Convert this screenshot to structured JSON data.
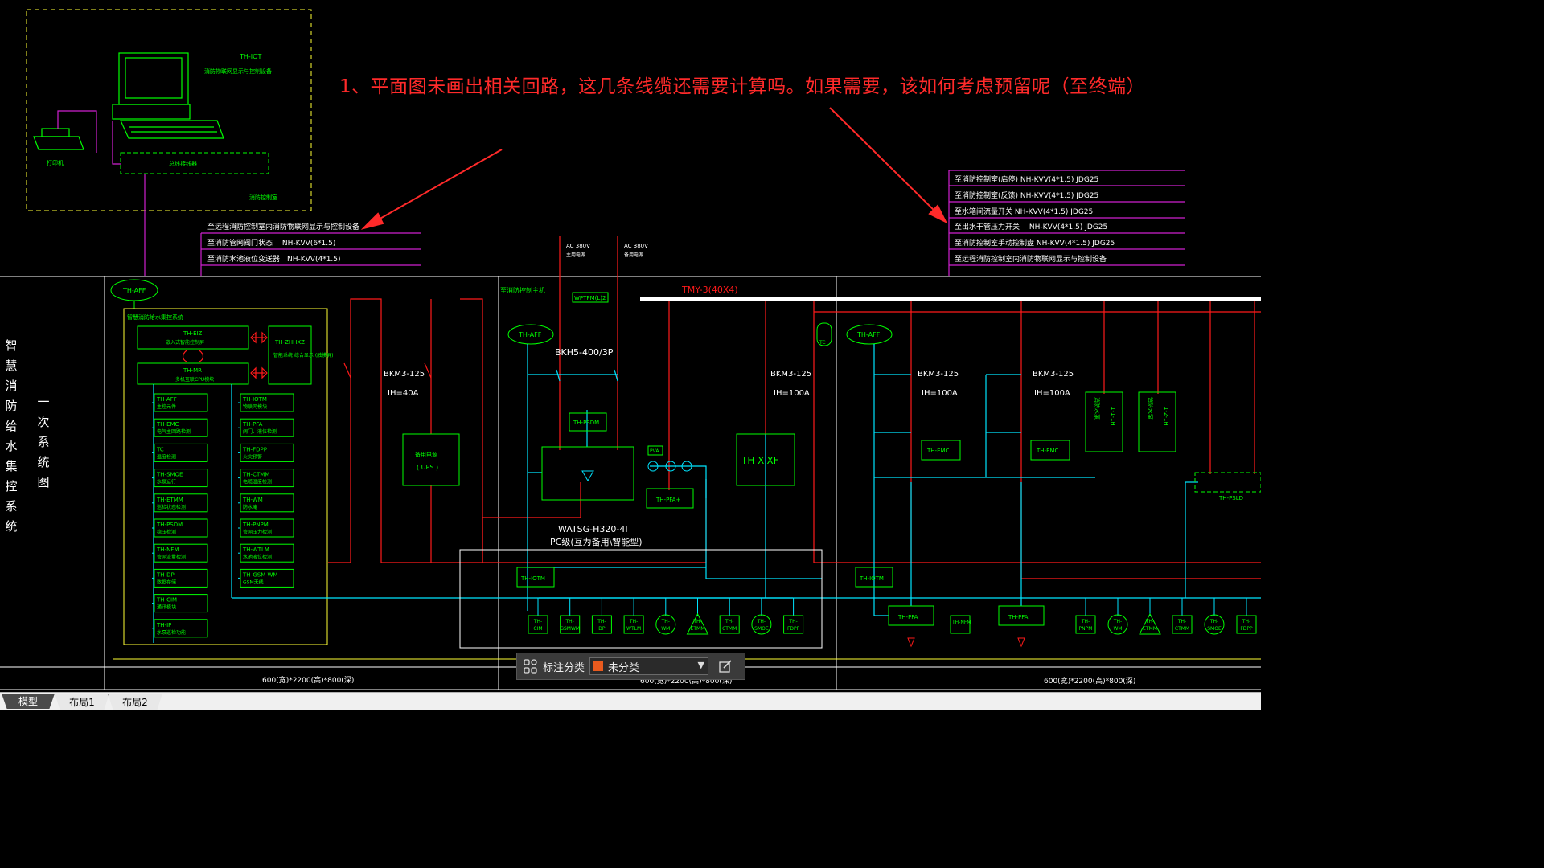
{
  "annotation": {
    "text": "1、平面图未画出相关回路，这几条线缆还需要计算吗。如果需要，该如何考虑预留呢（至终端）"
  },
  "title_vertical": [
    "智",
    "慧",
    "消",
    "防",
    "给",
    "水",
    "集",
    "控",
    "系",
    "统"
  ],
  "title_vertical_2": [
    "一",
    "次",
    "系",
    "统",
    "图"
  ],
  "top_left": {
    "device": "TH-IOT",
    "device_desc": "消防物联网显示与控制设备",
    "printer": "打印机",
    "bus": "总线接线器",
    "room": "消防控制室"
  },
  "cables_left": [
    "至远程消防控制室内消防物联网显示与控制设备",
    "至消防管网阀门状态　 NH-KVV(6*1.5)",
    "至消防水池液位变送器　NH-KVV(4*1.5)"
  ],
  "cables_right": [
    "至消防控制室(启停) NH-KVV(4*1.5) JDG25",
    "至消防控制室(反馈) NH-KVV(4*1.5) JDG25",
    "至水箱间流量开关 NH-KVV(4*1.5) JDG25",
    "至出水干管压力开关　 NH-KVV(4*1.5) JDG25",
    "至消防控制室手动控制盘 NH-KVV(4*1.5) JDG25",
    "至远程消防控制室内消防物联网显示与控制设备"
  ],
  "panel1": {
    "aff": "TH-AFF",
    "box_title": "智慧消防给水集控系统",
    "eiz": "TH-EIZ",
    "eiz_desc": "嵌入式智能控制屏",
    "mr": "TH-MR",
    "mr_desc": "多机互联CPU模块",
    "zhhxz": "TH-ZHHXZ",
    "zhhxz_desc": "智能系统 综合显示 (触摸屏)",
    "left_modules": [
      {
        "code": "TH-AFF",
        "desc": "主控元件"
      },
      {
        "code": "TH-EMC",
        "desc": "电气主回路检测"
      },
      {
        "code": "TC",
        "desc": "温度检测"
      },
      {
        "code": "TH-SMOE",
        "desc": "水泵运行"
      },
      {
        "code": "TH-ETMM",
        "desc": "巡检状态检测"
      },
      {
        "code": "TH-PSDM",
        "desc": "稳压检测"
      },
      {
        "code": "TH-NFM",
        "desc": "管网流量检测"
      },
      {
        "code": "TH-DP",
        "desc": "数据存储"
      },
      {
        "code": "TH-CIM",
        "desc": "通讯模块"
      },
      {
        "code": "TH-IP",
        "desc": "水泵巡检功能"
      }
    ],
    "right_modules": [
      {
        "code": "TH-IOTM",
        "desc": "物联网模块"
      },
      {
        "code": "TH-PFA",
        "desc": "阀门、液位检测"
      },
      {
        "code": "TH-FDPP",
        "desc": "火灾预警"
      },
      {
        "code": "TH-CTMM",
        "desc": "电缆温度检测"
      },
      {
        "code": "TH-WM",
        "desc": "防水淹"
      },
      {
        "code": "TH-PNPM",
        "desc": "管网压力检测"
      },
      {
        "code": "TH-WTLM",
        "desc": "水池液位检测"
      },
      {
        "code": "TH-GSM-WM",
        "desc": "GSM无线"
      }
    ],
    "bkm_label": "BKM3-125",
    "ih_label": "IH=40A",
    "ups_label": "备用电源",
    "ups_sub": "( UPS )",
    "footer": "600(宽)*2200(高)*800(深)"
  },
  "panel2": {
    "header": "至消防控制主机",
    "ac1": "AC 380V",
    "ac1_sub": "主用电源",
    "ac2": "AC 380V",
    "ac2_sub": "备用电源",
    "wptpm": "WPTPM(L)2",
    "aff": "TH-AFF",
    "bkh": "BKH5-400/3P",
    "psdm": "TH-PSDM",
    "pva": "PVA",
    "pfa_plus": "TH-PFA+",
    "watsg": "WATSG-H320-4I",
    "pc_label": "PC级(互为备用\\智能型)",
    "iotm": "TH-IOTM",
    "bus_label": "TMY-3(40X4)",
    "tc": "TC",
    "bkm_label": "BKM3-125",
    "ih_label": "IH=100A",
    "xf_label": "TH-X-XF",
    "bottom_modules": [
      "TH-CIM",
      "TH-GSMWM",
      "TH-DP",
      "TH-WTLM",
      "TH-WM",
      "TH-ETMM",
      "TH-CTMM",
      "TH-SMOE",
      "TH-FDPP"
    ],
    "footer": "600(宽)*2200(高)*800(深)"
  },
  "panel3": {
    "aff": "TH-AFF",
    "bkm_label": "BKM3-125",
    "ih_label": "IH=100A",
    "emc": "TH-EMC",
    "pump_label": "消防水泵",
    "pump_code": "1-1-1H",
    "pump_code_2": "1-2-1H",
    "iotm": "TH-IOTM",
    "pfa": "TH-PFA",
    "nfm": "TH-NFM",
    "psld": "TH-PSLD",
    "bottom_modules": [
      "TH-PNPM",
      "TH-WM",
      "TH-ETMM",
      "TH-CTMM",
      "TH-SMOE",
      "TH-FDPP"
    ],
    "footer": "600(宽)*2200(高)*800(深)"
  },
  "toolbar": {
    "label": "标注分类",
    "selected": "未分类",
    "swatch_color": "#e85a1e"
  },
  "tabs": [
    "模型",
    "布局1",
    "布局2"
  ],
  "colors": {
    "green": "#00ff00",
    "cyan": "#00e5ff",
    "red": "#ff1a1a",
    "magenta": "#d020d0",
    "yellow": "#ffff33",
    "white": "#ffffff"
  }
}
